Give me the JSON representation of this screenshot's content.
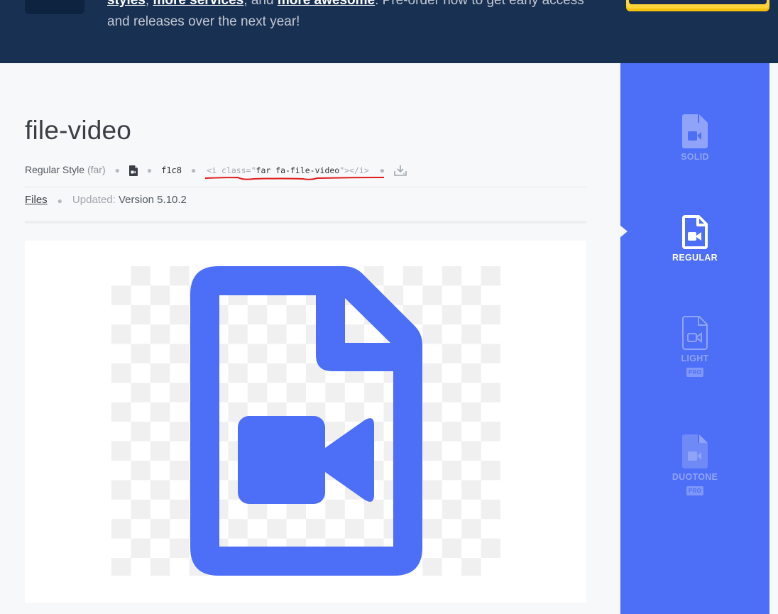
{
  "banner": {
    "text_link_styles": "styles",
    "text_sep1": ", ",
    "text_link_services": "more services",
    "text_mid": ", and ",
    "text_link_awesome": "more awesome",
    "text_after": ". Pre-order now to get early access and releases over the next year!"
  },
  "icon": {
    "name": "file-video",
    "style_label": "Regular Style",
    "style_prefix": "(far)",
    "unicode": "f1c8",
    "code": {
      "open": "<i class=\"",
      "classes": "far fa-file-video",
      "close": "\"></i>"
    },
    "category": "Files",
    "updated_label": "Updated:",
    "version": "Version 5.10.2"
  },
  "styles": [
    {
      "label": "SOLID",
      "selected": false,
      "pro": false
    },
    {
      "label": "REGULAR",
      "selected": true,
      "pro": false
    },
    {
      "label": "LIGHT",
      "selected": false,
      "pro": true,
      "badge": "PRO"
    },
    {
      "label": "DUOTONE",
      "selected": false,
      "pro": true,
      "badge": "PRO"
    }
  ],
  "colors": {
    "banner_bg": "#183153",
    "accent": "#4d6ef6",
    "highlight": "#ffd43b",
    "annotation_red": "#e01b1b"
  },
  "icons": [
    "file-video-icon",
    "download-icon",
    "logo-icon"
  ]
}
